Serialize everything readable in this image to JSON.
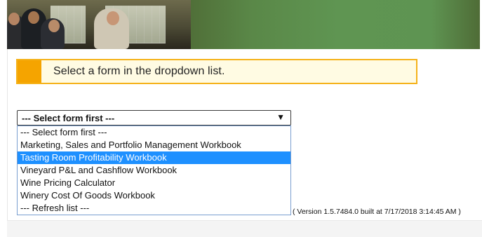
{
  "banner": {
    "image_icon": "team-photo-banner"
  },
  "notice": {
    "text": "Select a form in the dropdown list.",
    "accent_color": "#f5a400",
    "border_color": "#f5b21a",
    "background_color": "#fffbe3"
  },
  "form_select": {
    "selected_value": "--- Select form first ---",
    "arrow_icon": "triangle-down-icon",
    "options": [
      "--- Select form first ---",
      "Marketing, Sales and Portfolio Management Workbook",
      "Tasting Room Profitability Workbook",
      "Vineyard P&L and Cashflow Workbook",
      "Wine Pricing Calculator",
      "Winery Cost Of Goods Workbook",
      "--- Refresh list ---"
    ],
    "highlighted_option": "Tasting Room Profitability Workbook",
    "highlight_color": "#1e90ff"
  },
  "footer": {
    "version_text": "( Version 1.5.7484.0 built at 7/17/2018 3:14:45 AM )"
  },
  "colors": {
    "banner_green": "#5e9452"
  }
}
